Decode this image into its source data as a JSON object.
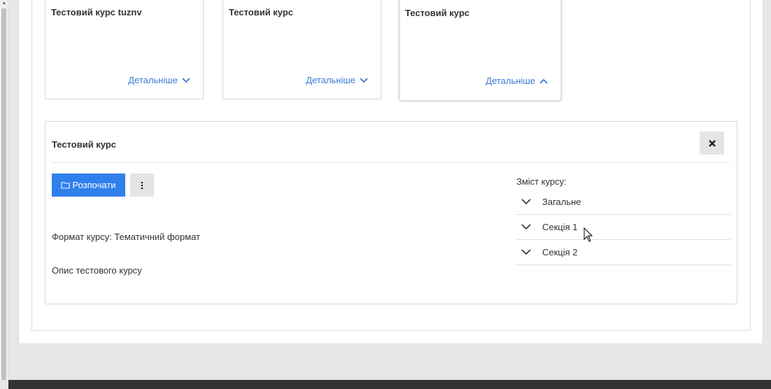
{
  "course_cards": [
    {
      "title": "Тестовий курс tuznv",
      "more_label": "Детальніше"
    },
    {
      "title": "Тестовий курс",
      "more_label": "Детальніше"
    },
    {
      "title": "Тестовий курс",
      "more_label": "Детальніше"
    }
  ],
  "detail": {
    "title": "Тестовий курс",
    "start_label": "Розпочати",
    "format_text": "Формат курсу: Тематичний формат",
    "description": "Опис тестового курсу",
    "contents_label": "Зміст курсу:",
    "sections": [
      {
        "label": "Загальне"
      },
      {
        "label": "Секція 1"
      },
      {
        "label": "Секція 2"
      }
    ]
  },
  "colors": {
    "accent": "#2f80ed",
    "link": "#3a7bd5",
    "footer": "#333333"
  }
}
